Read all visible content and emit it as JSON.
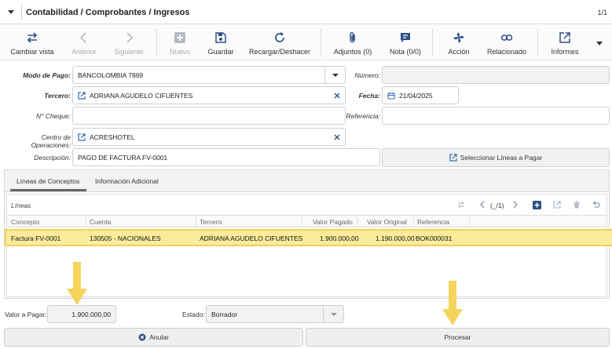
{
  "header": {
    "title": "Contabilidad / Comprobantes / Ingresos",
    "pager": "1/1"
  },
  "toolbar": {
    "cambiar_vista": "Cambiar vista",
    "anterior": "Anterior",
    "siguiente": "Siguiente",
    "nuevo": "Nuevo",
    "guardar": "Guardar",
    "recargar": "Recargar/Deshacer",
    "adjuntos": "Adjuntos (0)",
    "nota": "Nota (0/0)",
    "accion": "Acción",
    "relacionado": "Relacionado",
    "informes": "Informes"
  },
  "form": {
    "modo_pago_label": "Modo de Pago:",
    "modo_pago_value": "BANCOLOMBIA 7869",
    "numero_label": "Número:",
    "numero_value": "",
    "tercero_label": "Tercero:",
    "tercero_value": "ADRIANA AGUDELO CIFUENTES",
    "fecha_label": "Fecha:",
    "fecha_value": "21/04/2025",
    "cheque_label": "N° Cheque:",
    "cheque_value": "",
    "referencia_label": "Referencia:",
    "referencia_value": "",
    "centro_label": "Centro de Operaciones:",
    "centro_value": "ACRESHOTEL",
    "descripcion_label": "Descripción:",
    "descripcion_value": "PAGO DE FACTURA FV-0001",
    "seleccionar_label": "Seleccionar Líneas a Pagar"
  },
  "tabs": [
    {
      "label": "Líneas de Conceptos",
      "active": true
    },
    {
      "label": "Información Adicional",
      "active": false
    }
  ],
  "grid": {
    "title": "Líneas",
    "nav_text": "(_/1)",
    "columns": [
      "Concepto",
      "Cuenta",
      "Tercero",
      "Valor Pagado",
      "Valor Original",
      "Referencia"
    ],
    "rows": [
      {
        "concepto": "Factura FV-0001",
        "cuenta": "130505 - NACIONALES",
        "tercero": "ADRIANA AGUDELO CIFUENTES",
        "valor_pagado": "1.900.000,00",
        "valor_original": "1.190.000,00",
        "referencia": "BOK000031"
      }
    ]
  },
  "footer": {
    "valor_label": "Valor a Pagar:",
    "valor_value": "1.900.000,00",
    "estado_label": "Estado:",
    "estado_value": "Borrador",
    "anular": "Anular",
    "procesar": "Procesar"
  },
  "colors": {
    "highlight_row": "#fbec9c",
    "highlight_border": "#f0cf59",
    "arrow": "#f5d45e",
    "link_icon": "#2b6cb0",
    "toolbar_icon": "#2d4f86"
  }
}
